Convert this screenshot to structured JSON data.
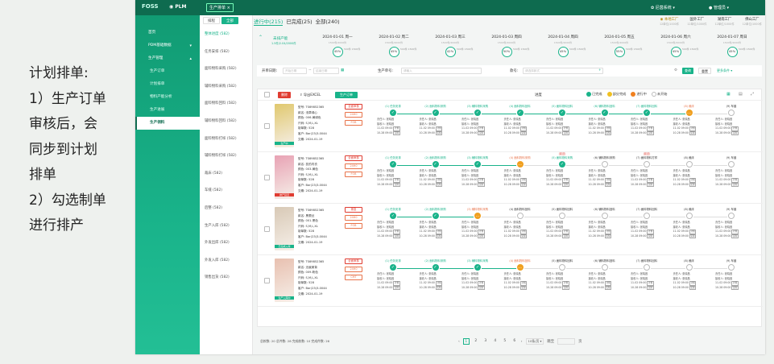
{
  "caption": {
    "title": "计划排单:",
    "point1_lines": [
      "1）生产订单",
      "审核后，会",
      "同步到计划",
      "排单"
    ],
    "point2_lines": [
      "2）勾选制单",
      "进行排产"
    ]
  },
  "topbar": {
    "logo": "FOSS",
    "product": "PLM",
    "tab": "生产排单",
    "company": "尼茵系统",
    "user": "管理员"
  },
  "sidebar": {
    "items": [
      {
        "label": "首页",
        "sub": false,
        "chevron": "",
        "active": false
      },
      {
        "label": "PDM基础数据",
        "sub": false,
        "chevron": "▾",
        "active": false
      },
      {
        "label": "生产管理",
        "sub": false,
        "chevron": "▴",
        "active": false
      },
      {
        "label": "生产订单",
        "sub": true,
        "chevron": "",
        "active": false
      },
      {
        "label": "计划排单",
        "sub": true,
        "chevron": "",
        "active": false
      },
      {
        "label": "物料产能分析",
        "sub": true,
        "chevron": "",
        "active": false
      },
      {
        "label": "生产进展",
        "sub": true,
        "chevron": "",
        "active": false
      },
      {
        "label": "生产领料",
        "sub": true,
        "chevron": "",
        "active": true
      }
    ]
  },
  "subnav": {
    "tabs": [
      "排程",
      "全部"
    ],
    "items": [
      "整体进度 (582)",
      "任务安排 (582)",
      "面料物料采购 (582)",
      "辅料物料采购 (582)",
      "面料物料回料 (582)",
      "辅料物料回料 (582)",
      "面料物料打样 (582)",
      "辅料物料打样 (582)",
      "裁床 (582)",
      "车缝 (582)",
      "后整 (582)",
      "生产入库 (582)",
      "外发出库 (582)",
      "外发入库 (582)",
      "销售出货 (582)"
    ]
  },
  "status_tabs": [
    "进行中(215)",
    "已完成(25)",
    "全部(240)"
  ],
  "factories": [
    {
      "name": "本地工厂",
      "sub": "12单位/1000件"
    },
    {
      "name": "国外工厂",
      "sub": "12单位/1000件"
    },
    {
      "name": "湖南工厂",
      "sub": "12单位/1000件"
    },
    {
      "name": "佛山工厂",
      "sub": "12单位/1000件"
    }
  ],
  "capacity": {
    "title": "未排产能",
    "sub": "1.5件/2.04/2000件"
  },
  "dates": [
    {
      "date": "2024-01-01 周一",
      "sub": "1500件/2000件",
      "pct": "45%",
      "mini": "500件 1500件"
    },
    {
      "date": "2024-01-02 周二",
      "sub": "1500件/2000件",
      "pct": "45%",
      "mini": "500件 1500件"
    },
    {
      "date": "2024-01-03 周三",
      "sub": "1500件/2000件",
      "pct": "42%",
      "mini": "500件 1500件"
    },
    {
      "date": "2024-01-03 周四",
      "sub": "1500件/2000件",
      "pct": "50%",
      "mini": "500件 1500件"
    },
    {
      "date": "2024-01-04 周四",
      "sub": "1500件/2000件",
      "pct": "45%",
      "mini": "500件 1500件"
    },
    {
      "date": "2024-01-05 周五",
      "sub": "1500件/2000件",
      "pct": "55%",
      "mini": "500件 1500件"
    },
    {
      "date": "2024-01-06 周六",
      "sub": "1500件/2000件",
      "pct": "45%",
      "mini": "500件 1500件"
    },
    {
      "date": "2024-01-07 周日",
      "sub": "1500件/2000件",
      "pct": "45%",
      "mini": "500件 1500件"
    }
  ],
  "filters": {
    "date_label": "开单日期:",
    "date_start": "开始日期",
    "date_to": "~",
    "date_end": "结束日期",
    "order_label": "生产单号:",
    "order_ph": "请输入",
    "style_label": "款号:",
    "style_ph": "请选择款式",
    "search_btn": "查询",
    "reset_btn": "重置",
    "more_btn": "更多条件 ▾"
  },
  "toolbar": {
    "delete": "删除",
    "export": "导出EXCEL",
    "schedule": "生产订单",
    "progress": "进度"
  },
  "legend": [
    {
      "label": "已完成",
      "color": "#19b38a"
    },
    {
      "label": "部分完成",
      "color": "#f0c020"
    },
    {
      "label": "进行中",
      "color": "#f08020"
    },
    {
      "label": "未开始",
      "color": "#ffffff"
    }
  ],
  "orders": [
    {
      "thumb_tag": "生产中",
      "thumb_color": "#e0c86e",
      "tag_red": false,
      "info": [
        "型号: TS69852365",
        "款名: 浅草绿心",
        "颜色: 006-黄绿色",
        "尺码: S,M,L,XL",
        "制单数: 528",
        "客户: Bar(23)3-0044",
        "交期: 2024-01-19"
      ],
      "badges": [
        "全面审核",
        "24H0",
        "FOB"
      ],
      "steps": [
        {
          "name": "(1) 任务安排",
          "state": "done",
          "delay": ""
        },
        {
          "name": "(2) 面料物料采购",
          "state": "done",
          "delay": ""
        },
        {
          "name": "(3) 辅料物料采购",
          "state": "done",
          "delay": ""
        },
        {
          "name": "(4) 面料物料回料",
          "state": "done",
          "delay": ""
        },
        {
          "name": "(5) 面料物料回料",
          "state": "done",
          "delay": ""
        },
        {
          "name": "(6) 辅料物料回料",
          "state": "done",
          "delay": ""
        },
        {
          "name": "(7) 面料物料回料",
          "state": "done",
          "delay": ""
        },
        {
          "name": "(8) 裁床",
          "state": "prog",
          "delay": ""
        },
        {
          "name": "(9) 车缝",
          "state": "todo",
          "delay": ""
        }
      ]
    },
    {
      "thumb_tag": "排产延迟",
      "thumb_color": "#e8a2b4",
      "tag_red": true,
      "info": [
        "型号: TS69852365",
        "款名: 蕊的内衣",
        "颜色: 003-黄色",
        "尺码: S,M,L,XL",
        "制单数: 528",
        "客户: Bar(23)3-0044",
        "交期: 2024-01-19"
      ],
      "badges": [
        "全面审核",
        "24H0",
        "FOB"
      ],
      "steps": [
        {
          "name": "(1) 任务安排",
          "state": "done",
          "delay": ""
        },
        {
          "name": "(2) 面料物料采购",
          "state": "done",
          "delay": ""
        },
        {
          "name": "(3) 辅料物料采购",
          "state": "done",
          "delay": ""
        },
        {
          "name": "(4) 面料物料采购",
          "state": "prog",
          "delay": ""
        },
        {
          "name": "(5) 面料物料采购",
          "state": "done",
          "delay": "(延迟)"
        },
        {
          "name": "(6) 辅料物料采购",
          "state": "todo",
          "delay": ""
        },
        {
          "name": "(7) 面料物料打样",
          "state": "todo",
          "delay": "(延迟)"
        },
        {
          "name": "(8) 裁床",
          "state": "todo",
          "delay": ""
        },
        {
          "name": "(9) 车缝",
          "state": "todo",
          "delay": ""
        }
      ]
    },
    {
      "thumb_tag": "已完成入库",
      "thumb_color": "#d8c9b6",
      "tag_red": false,
      "info": [
        "型号: TS69852365",
        "款名: 黑蕾丝",
        "颜色: 001-黑色",
        "尺码: S,M,L,XL",
        "制单数: 528",
        "客户: Bar(23)3-0044",
        "交期: 2024-01-19"
      ],
      "badges": [
        "紧急",
        "24H0",
        "FOB"
      ],
      "steps": [
        {
          "name": "(1) 任务安排",
          "state": "done",
          "delay": ""
        },
        {
          "name": "(2) 面料物料采购",
          "state": "done",
          "delay": ""
        },
        {
          "name": "(3) 辅料物料采购",
          "state": "prog",
          "delay": ""
        },
        {
          "name": "(4) 面料物料回料",
          "state": "todo",
          "delay": ""
        },
        {
          "name": "(5) 面料物料回料",
          "state": "todo",
          "delay": ""
        },
        {
          "name": "(6) 辅料物料回料",
          "state": "todo",
          "delay": ""
        },
        {
          "name": "(7) 面料物料回料",
          "state": "todo",
          "delay": ""
        },
        {
          "name": "(8) 裁床",
          "state": "todo",
          "delay": ""
        },
        {
          "name": "(9) 车缝",
          "state": "todo",
          "delay": ""
        }
      ]
    },
    {
      "thumb_tag": "生产入库中",
      "thumb_color": "#e8c0b0",
      "tag_red": false,
      "info": [
        "型号: TS69852365",
        "款名: 无痕美背",
        "颜色: 009-粉色",
        "尺码: S,M,L,XL",
        "制单数: 528",
        "客户: Bar(23)3-0044",
        "交期: 2024-01-19"
      ],
      "badges": [
        "全面审核",
        "24H0",
        "CMT"
      ],
      "steps": [
        {
          "name": "(1) 任务安排",
          "state": "done",
          "delay": ""
        },
        {
          "name": "(2) 面料物料采购",
          "state": "done",
          "delay": ""
        },
        {
          "name": "(3) 辅料物料采购",
          "state": "done",
          "delay": ""
        },
        {
          "name": "(4) 面料物料回料",
          "state": "prog",
          "delay": ""
        },
        {
          "name": "(5) 面料物料回料",
          "state": "todo",
          "delay": ""
        },
        {
          "name": "(6) 辅料物料回料",
          "state": "todo",
          "delay": ""
        },
        {
          "name": "(7) 面料物料回料",
          "state": "todo",
          "delay": ""
        },
        {
          "name": "(8) 裁床",
          "state": "todo",
          "delay": ""
        },
        {
          "name": "(9) 车缝",
          "state": "todo",
          "delay": ""
        }
      ]
    }
  ],
  "step_text": {
    "owner": "责任人: 张晓昌",
    "receiver": "接收人: 张晓昌",
    "plan": "11-02 09:00",
    "actual": "10-28 09:00",
    "plan_mark": "计划",
    "actual_mark": "实际"
  },
  "footer": {
    "stats": "总款数: 20  总件数: 28  完成款数: 10  完成件数: 26",
    "pages": [
      "1",
      "2",
      "3",
      "4",
      "5",
      "6"
    ],
    "page_size": "10条/页 ▾",
    "jump_label": "跳至",
    "jump_suffix": "页"
  }
}
